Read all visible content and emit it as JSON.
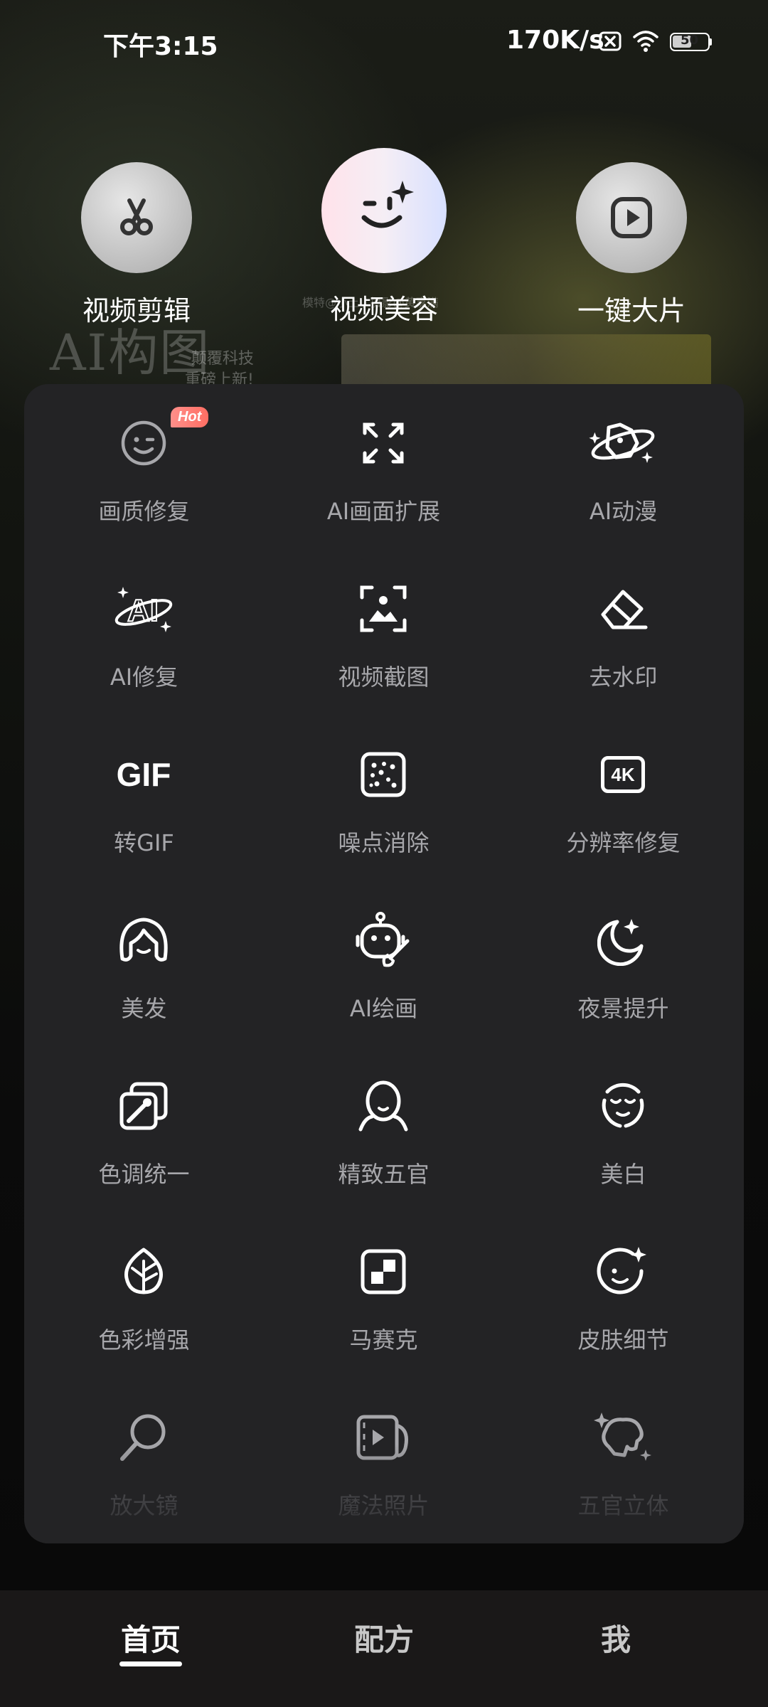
{
  "status_bar": {
    "time": "下午3:15",
    "net_speed": "170K/s",
    "battery": "50"
  },
  "background_promo": {
    "title": "AI构图",
    "subtitle_1": "颠覆科技",
    "subtitle_2": "重磅上新!",
    "top_caption": "模特@小土 / 摄影@黄嘉满"
  },
  "shortcuts": [
    {
      "label": "视频剪辑",
      "icon": "scissors-icon"
    },
    {
      "label": "视频美容",
      "icon": "wink-face-icon"
    },
    {
      "label": "一键大片",
      "icon": "play-square-icon"
    }
  ],
  "tools": [
    {
      "label": "画质修复",
      "icon": "smile-face-icon",
      "badge": "Hot"
    },
    {
      "label": "AI画面扩展",
      "icon": "expand-icon"
    },
    {
      "label": "AI动漫",
      "icon": "anime-planet-icon"
    },
    {
      "label": "AI修复",
      "icon": "ai-sparkle-icon"
    },
    {
      "label": "视频截图",
      "icon": "screenshot-icon"
    },
    {
      "label": "去水印",
      "icon": "eraser-icon"
    },
    {
      "label": "转GIF",
      "icon": "gif-icon",
      "icon_text": "GIF"
    },
    {
      "label": "噪点消除",
      "icon": "noise-dots-icon"
    },
    {
      "label": "分辨率修复",
      "icon": "4k-icon",
      "icon_text": "4K"
    },
    {
      "label": "美发",
      "icon": "hair-icon"
    },
    {
      "label": "AI绘画",
      "icon": "robot-paint-icon"
    },
    {
      "label": "夜景提升",
      "icon": "moon-icon"
    },
    {
      "label": "色调统一",
      "icon": "color-pick-icon"
    },
    {
      "label": "精致五官",
      "icon": "face-outline-icon"
    },
    {
      "label": "美白",
      "icon": "whitening-face-icon"
    },
    {
      "label": "色彩增强",
      "icon": "leaf-icon"
    },
    {
      "label": "马赛克",
      "icon": "mosaic-icon"
    },
    {
      "label": "皮肤细节",
      "icon": "skin-sparkle-icon"
    },
    {
      "label": "放大镜",
      "icon": "magnifier-icon"
    },
    {
      "label": "魔法照片",
      "icon": "magic-photo-icon"
    },
    {
      "label": "五官立体",
      "icon": "face-3d-icon"
    }
  ],
  "bottom_nav": {
    "home": "首页",
    "recipes": "配方",
    "me": "我"
  },
  "colors": {
    "panel_bg": "#232325",
    "label_gray": "#a7a7ab",
    "hot_badge": "#ff7a70"
  }
}
